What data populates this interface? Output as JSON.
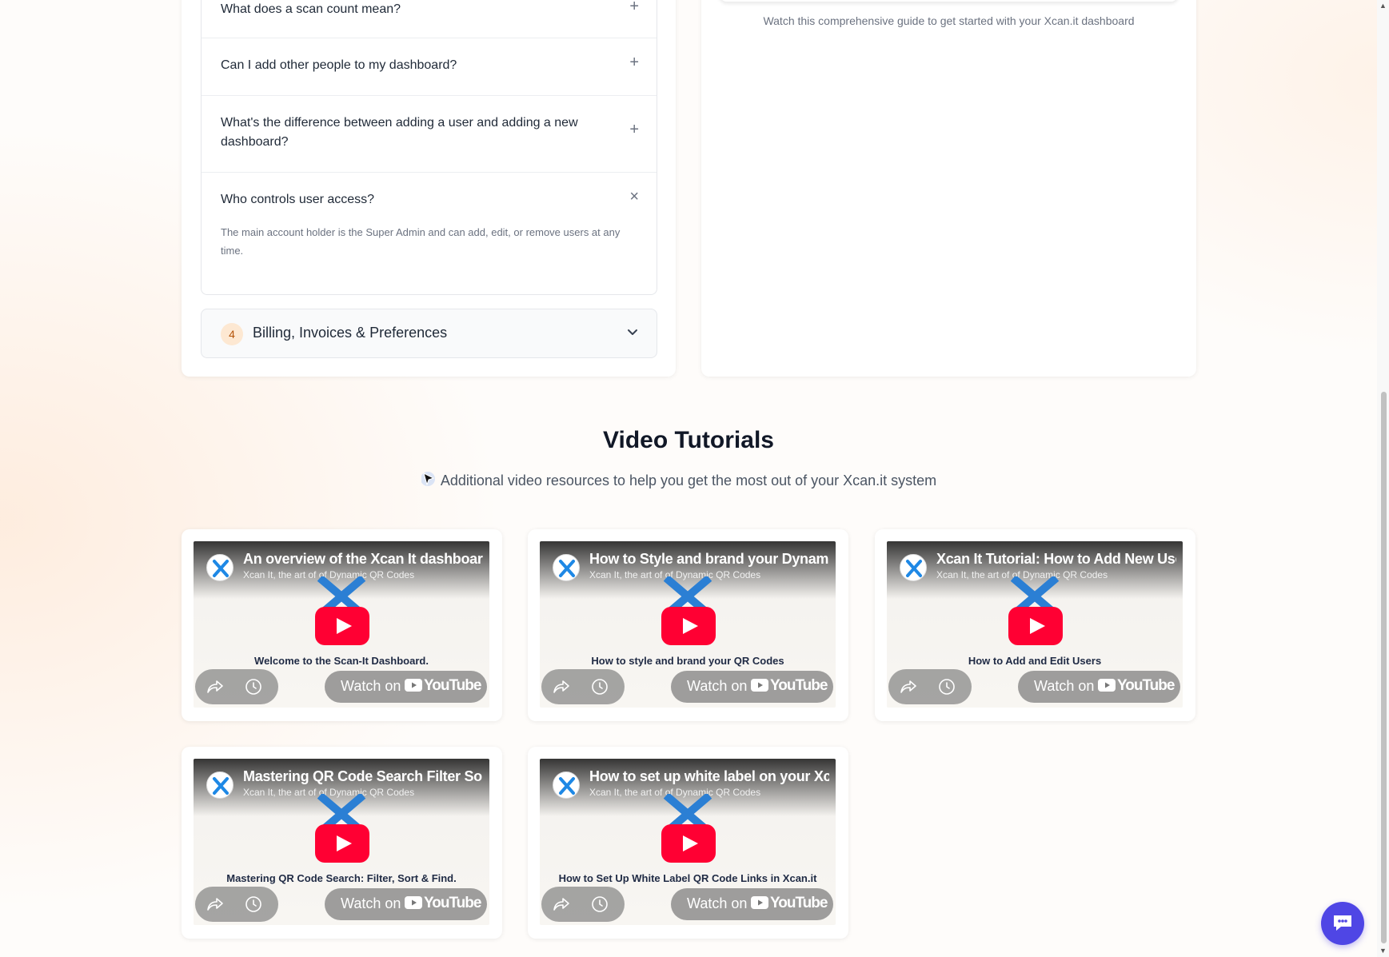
{
  "faq": {
    "items": [
      {
        "question": "What does a scan count mean?",
        "toggle": "+"
      },
      {
        "question": "Can I add other people to my dashboard?",
        "toggle": "+"
      },
      {
        "question": "What's the difference between adding a user and adding a new dashboard?",
        "toggle": "+"
      },
      {
        "question": "Who controls user access?",
        "toggle": "×",
        "answer": "The main account holder is the Super Admin and can add, edit, or remove users at any time."
      }
    ],
    "billing": {
      "number": "4",
      "title": "Billing, Invoices & Preferences"
    }
  },
  "guide": {
    "caption": "Watch this comprehensive guide to get started with your Xcan.it dashboard"
  },
  "tutorials": {
    "title": "Video Tutorials",
    "subtitle": "Additional video resources to help you get the most out of your Xcan.it system",
    "channel": "Xcan It, the art of of Dynamic QR Codes",
    "watch_label": "Watch on",
    "youtube_label": "YouTube",
    "videos": [
      {
        "title": "An overview of the Xcan It dashboard",
        "caption": "Welcome to the Scan-It Dashboard."
      },
      {
        "title": "How to Style and brand your Dynamic QR Codes",
        "caption": "How to style and brand your QR Codes"
      },
      {
        "title": "Xcan It Tutorial: How to Add New Users",
        "caption": "How to Add and Edit Users"
      },
      {
        "title": "Mastering QR Code Search Filter Sort",
        "caption": "Mastering QR Code Search: Filter, Sort & Find."
      },
      {
        "title": "How to set up white label on your Xcan.it",
        "caption": "How to Set Up White Label QR Code Links in Xcan.it"
      }
    ]
  },
  "colors": {
    "accent": "#4f46e5",
    "badge_bg": "#fde8d2",
    "youtube_red": "#ff0033"
  },
  "icons": {
    "chat": "chat-bubble-icon",
    "share": "share-icon",
    "watch_later": "clock-icon",
    "play": "youtube-play-icon"
  }
}
